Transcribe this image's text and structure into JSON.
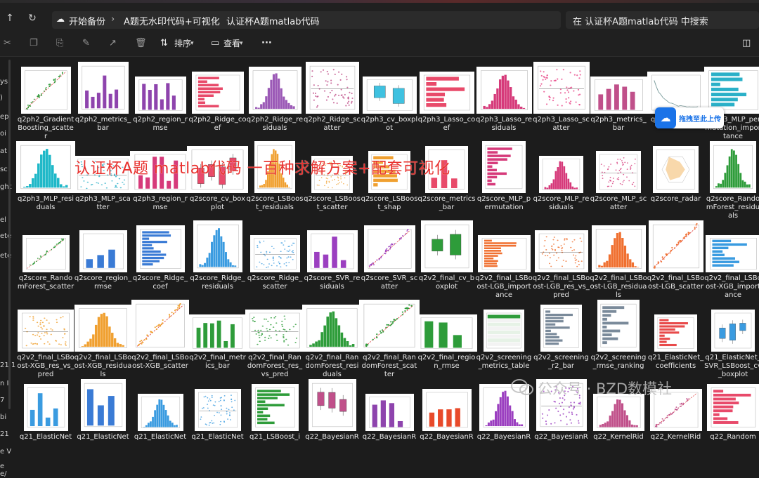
{
  "address": {
    "crumbs": [
      "开始备份",
      "A题无水印代码+可视化",
      "认证杯A题matlab代码"
    ],
    "search_placeholder": "在 认证杯A题matlab代码 中搜索"
  },
  "toolbar": {
    "sort_label": "排序",
    "view_label": "查看",
    "more_label": "···"
  },
  "sidebar": {
    "fragments": [
      "ys",
      ")",
      "ep",
      "oi",
      "at",
      "sc",
      "ght",
      "el",
      "ete",
      "ete",
      "21.1",
      "n I",
      "7",
      "bi",
      "21",
      "e V",
      "e",
      "e/"
    ]
  },
  "overlay": {
    "watermark": "认证杯A题 matlab代码 一百种求解方案+配套可视化",
    "upload_label": "拖拽至此上传",
    "wechat": "公众号 · BZD数模社"
  },
  "files": [
    {
      "name": "q2ph2_GradientBoosting_scatter",
      "plot": "diag",
      "color": "#2e9c3a"
    },
    {
      "name": "q2ph2_metrics_bar",
      "plot": "bars",
      "color": "#8e44ad"
    },
    {
      "name": "q2ph2_region_rmse",
      "plot": "bars",
      "color": "#8e44ad"
    },
    {
      "name": "q2ph2_Ridge_coef",
      "plot": "hbar",
      "color": "#e84a6a"
    },
    {
      "name": "q2ph2_Ridge_residuals",
      "plot": "hist",
      "color": "#9b59b6"
    },
    {
      "name": "q2ph2_Ridge_scatter",
      "plot": "scatter",
      "color": "#c0508a"
    },
    {
      "name": "q2ph3_cv_boxplot",
      "plot": "box",
      "color": "#3fc1e0"
    },
    {
      "name": "q2ph3_Lasso_coef",
      "plot": "hbar",
      "color": "#e84a6a"
    },
    {
      "name": "q2ph3_Lasso_residuals",
      "plot": "hist",
      "color": "#d63a7a"
    },
    {
      "name": "q2ph3_Lasso_scatter",
      "plot": "scatter",
      "color": "#e84a8a"
    },
    {
      "name": "q2ph3_metrics_bar",
      "plot": "bars",
      "color": "#c0508a"
    },
    {
      "name": "q2ph3_MLP_lo",
      "plot": "line",
      "color": "#7a9c9c"
    },
    {
      "name": "q2ph3_MLP_permutation_importance",
      "plot": "hbar",
      "color": "#2ab0c8"
    },
    {
      "name": "q2ph3_MLP_residuals",
      "plot": "hist",
      "color": "#1fb8c8"
    },
    {
      "name": "q2ph3_MLP_scatter",
      "plot": "scatter",
      "color": "#2ab0c8"
    },
    {
      "name": "q2ph3_region_rmse",
      "plot": "bars",
      "color": "#d63a7a"
    },
    {
      "name": "q2score_cv_boxplot",
      "plot": "box",
      "color": "#e84a6a"
    },
    {
      "name": "q2score_LSBoost_residuals",
      "plot": "hist",
      "color": "#f0a030"
    },
    {
      "name": "q2score_LSBoost_scatter",
      "plot": "scatter",
      "color": "#f0a030"
    },
    {
      "name": "q2score_LSBoost_shap",
      "plot": "hbar",
      "color": "#f0a030"
    },
    {
      "name": "q2score_metrics_bar",
      "plot": "bars",
      "color": "#e84a6a"
    },
    {
      "name": "q2score_MLP_permutation",
      "plot": "hbar",
      "color": "#d63a7a"
    },
    {
      "name": "q2score_MLP_residuals",
      "plot": "hist",
      "color": "#d63a7a"
    },
    {
      "name": "q2score_MLP_scatter",
      "plot": "scatter",
      "color": "#d63a7a"
    },
    {
      "name": "q2score_radar",
      "plot": "radar",
      "color": "#f0a030"
    },
    {
      "name": "q2score_RandomForest_residuals",
      "plot": "hist",
      "color": "#2e9c3a"
    },
    {
      "name": "q2score_RandomForest_scatter",
      "plot": "diag",
      "color": "#2e9c3a"
    },
    {
      "name": "q2score_region_rmse",
      "plot": "bars",
      "color": "#3a7bd5"
    },
    {
      "name": "q2score_Ridge_coef",
      "plot": "hbar",
      "color": "#3a7bd5"
    },
    {
      "name": "q2score_Ridge_residuals",
      "plot": "hist",
      "color": "#3a9be0"
    },
    {
      "name": "q2score_Ridge_scatter",
      "plot": "scatter",
      "color": "#3a9be0"
    },
    {
      "name": "q2score_SVR_residuals",
      "plot": "bars",
      "color": "#9b3fc0"
    },
    {
      "name": "q2score_SVR_scatter",
      "plot": "diag",
      "color": "#9b3fc0"
    },
    {
      "name": "q2v2_final_cv_boxplot",
      "plot": "box",
      "color": "#2e9c3a"
    },
    {
      "name": "q2v2_final_LSBoost-LGB_importance",
      "plot": "hbar",
      "color": "#f07030"
    },
    {
      "name": "q2v2_final_LSBoost-LGB_res_vs_pred",
      "plot": "scatter",
      "color": "#f07030"
    },
    {
      "name": "q2v2_final_LSBoost-LGB_residuals",
      "plot": "hist",
      "color": "#f07030"
    },
    {
      "name": "q2v2_final_LSBoost-LGB_scatter",
      "plot": "diag",
      "color": "#f07030"
    },
    {
      "name": "q2v2_final_LSBoost-XGB_importance",
      "plot": "hbar",
      "color": "#3a9be0"
    },
    {
      "name": "q2v2_final_LSBoost-XGB_res_vs_pred",
      "plot": "scatter",
      "color": "#f0a030"
    },
    {
      "name": "q2v2_final_LSBoost-XGB_residuals",
      "plot": "hist",
      "color": "#f0a030"
    },
    {
      "name": "q2v2_final_LSBoost-XGB_scatter",
      "plot": "diag",
      "color": "#f0a030"
    },
    {
      "name": "q2v2_final_metrics_bar",
      "plot": "bars",
      "color": "#2e9c3a"
    },
    {
      "name": "q2v2_final_RandomForest_res_vs_pred",
      "plot": "scatter",
      "color": "#2e9c3a"
    },
    {
      "name": "q2v2_final_RandomForest_residuals",
      "plot": "hist",
      "color": "#2e9c3a"
    },
    {
      "name": "q2v2_final_RandomForest_scatter",
      "plot": "diag",
      "color": "#2e9c3a"
    },
    {
      "name": "q2v2_final_region_rmse",
      "plot": "bars",
      "color": "#2e9c3a"
    },
    {
      "name": "q2v2_screening_metrics_table",
      "plot": "table",
      "color": "#2e9c3a"
    },
    {
      "name": "q2v2_screening_r2_bar",
      "plot": "hbar",
      "color": "#7a8a9a"
    },
    {
      "name": "q2v2_screening_rmse_ranking",
      "plot": "hbar",
      "color": "#7a8a9a"
    },
    {
      "name": "q21_ElasticNet_coefficients",
      "plot": "hbar",
      "color": "#e84a4a"
    },
    {
      "name": "q21_ElasticNet_SVR_LSBoost_cv_boxplot",
      "plot": "box",
      "color": "#3a9be0"
    },
    {
      "name": "q21_ElasticNet",
      "plot": "bars",
      "color": "#3a9be0"
    },
    {
      "name": "q21_ElasticNet",
      "plot": "bars",
      "color": "#3a7bd5"
    },
    {
      "name": "q21_ElasticNet",
      "plot": "hist",
      "color": "#3a9be0"
    },
    {
      "name": "q21_ElasticNet",
      "plot": "scatter",
      "color": "#3a9be0"
    },
    {
      "name": "q21_LSBoost_i",
      "plot": "hbar",
      "color": "#2e9c3a"
    },
    {
      "name": "q22_BayesianR",
      "plot": "box",
      "color": "#c0508a"
    },
    {
      "name": "q22_BayesianR",
      "plot": "bars",
      "color": "#8e44ad"
    },
    {
      "name": "q22_BayesianR",
      "plot": "bars",
      "color": "#e84a2a"
    },
    {
      "name": "q22_BayesianR",
      "plot": "hist",
      "color": "#9b3fc0"
    },
    {
      "name": "q22_BayesianR",
      "plot": "scatter",
      "color": "#9b3fc0"
    },
    {
      "name": "q22_KernelRid",
      "plot": "hist",
      "color": "#c0508a"
    },
    {
      "name": "q22_KernelRid",
      "plot": "diag",
      "color": "#c0508a"
    },
    {
      "name": "q22_Random",
      "plot": "hbar",
      "color": "#e84a6a"
    }
  ]
}
